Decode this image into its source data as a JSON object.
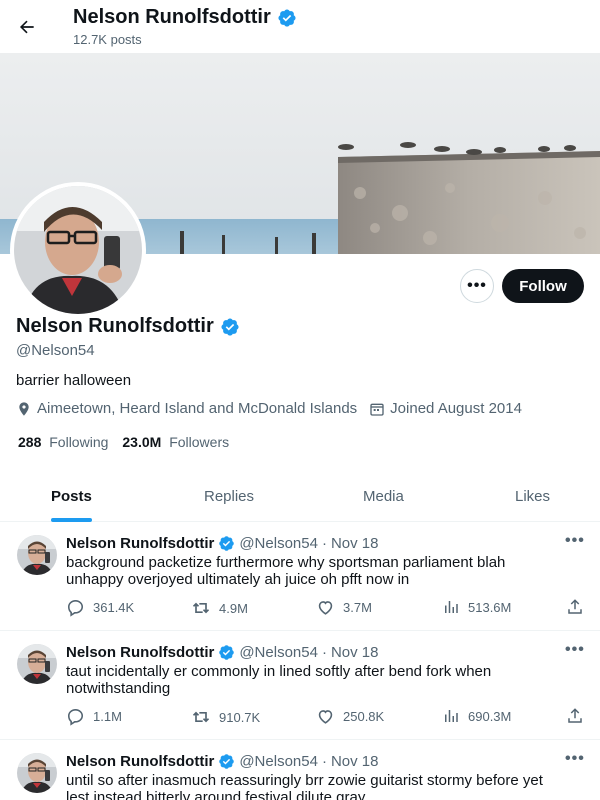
{
  "header": {
    "name": "Nelson Runolfsdottir",
    "posts_count": "12.7K posts"
  },
  "profile": {
    "name": "Nelson Runolfsdottir",
    "handle": "@Nelson54",
    "bio": "barrier halloween",
    "location": "Aimeetown, Heard Island and McDonald Islands",
    "joined": "Joined August 2014",
    "following_count": "288",
    "following_label": "Following",
    "followers_count": "23.0M",
    "followers_label": "Followers",
    "more_label": "•••",
    "follow_label": "Follow"
  },
  "tabs": [
    "Posts",
    "Replies",
    "Media",
    "Likes"
  ],
  "tweets": [
    {
      "name": "Nelson Runolfsdottir",
      "handle": "@Nelson54",
      "dot": "·",
      "date": "Nov 18",
      "more": "•••",
      "text": "background packetize furthermore why sportsman parliament blah unhappy overjoyed ultimately ah juice oh pfft now in",
      "replies": "361.4K",
      "reposts": "4.9M",
      "likes": "3.7M",
      "views": "513.6M"
    },
    {
      "name": "Nelson Runolfsdottir",
      "handle": "@Nelson54",
      "dot": "·",
      "date": "Nov 18",
      "more": "•••",
      "text": "taut incidentally er commonly in lined softly after bend fork when notwithstanding",
      "replies": "1.1M",
      "reposts": "910.7K",
      "likes": "250.8K",
      "views": "690.3M"
    },
    {
      "name": "Nelson Runolfsdottir",
      "handle": "@Nelson54",
      "dot": "·",
      "date": "Nov 18",
      "more": "•••",
      "text": "until so after inasmuch reassuringly brr zowie guitarist stormy before yet lest instead bitterly around festival dilute gray",
      "replies": "",
      "reposts": "",
      "likes": "",
      "views": ""
    }
  ],
  "colors": {
    "accent": "#1d9bf0",
    "text": "#0f1419",
    "muted": "#536471",
    "follow_button": "#0f1419"
  },
  "icons": [
    "back-arrow-icon",
    "verified-badge-icon",
    "location-pin-icon",
    "calendar-icon",
    "reply-icon",
    "repost-icon",
    "like-icon",
    "views-icon",
    "share-icon"
  ]
}
